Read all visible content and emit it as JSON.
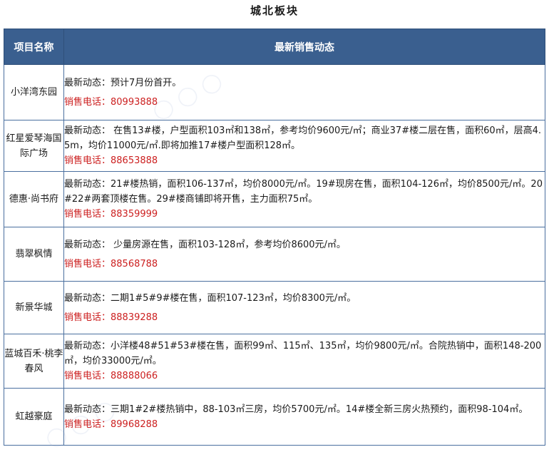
{
  "title": "城北板块",
  "table": {
    "headers": {
      "name": "项目名称",
      "info": "最新销售动态"
    },
    "rows": [
      {
        "name": "小洋湾东园",
        "news": "最新动态：预计7月份首开。",
        "phone": "销售电话：80993888"
      },
      {
        "name": "红星爱琴海国际广场",
        "news": "最新动态：  在售13#楼，户型面积103㎡和138㎡，参考均价9600元/㎡；商业37#楼二层在售，面积60㎡，层高4.5m，均价11000元/㎡.即将加推17#楼户型面积128㎡。",
        "phone": "销售电话：88653888"
      },
      {
        "name": "德惠·尚书府",
        "news": "最新动态：21#楼热销，面积106-137㎡，均价8000元/㎡。19#现房在售，面积104-126㎡，均价8500元/㎡。20#22#两套顶楼在售。29#楼商铺即将开售，主力面积75㎡。",
        "phone": "销售电话：88359999"
      },
      {
        "name": "翡翠枫情",
        "news": "最新动态： 少量房源在售，面积103-128㎡，参考均价8600元/㎡。",
        "phone": "销售电话：88568788"
      },
      {
        "name": "新景华城",
        "news": "最新动态：二期1#5#9#楼在售，面积107-123㎡，均价8300元/㎡。",
        "phone": "销售电话：88839288"
      },
      {
        "name": "蓝城百禾·桃李春风",
        "news": "最新动态：小洋楼48#51#53#楼在售，面积99㎡、115㎡、135㎡，均价9800元/㎡。合院热销中，面积148-200㎡，均价33000元/㎡。",
        "phone": "销售电话：88888066"
      },
      {
        "name": "虹越豪庭",
        "news": "最新动态：三期1#2#楼热销中，88-103㎡三房，均价5700元/㎡。14#楼全新三房火热预约，面积98-104㎡。",
        "phone": "销售电话：89968288"
      }
    ]
  },
  "colors": {
    "header_bg": "#3a5f8f",
    "border": "#4a6f9f",
    "phone": "#cc1f1f"
  }
}
